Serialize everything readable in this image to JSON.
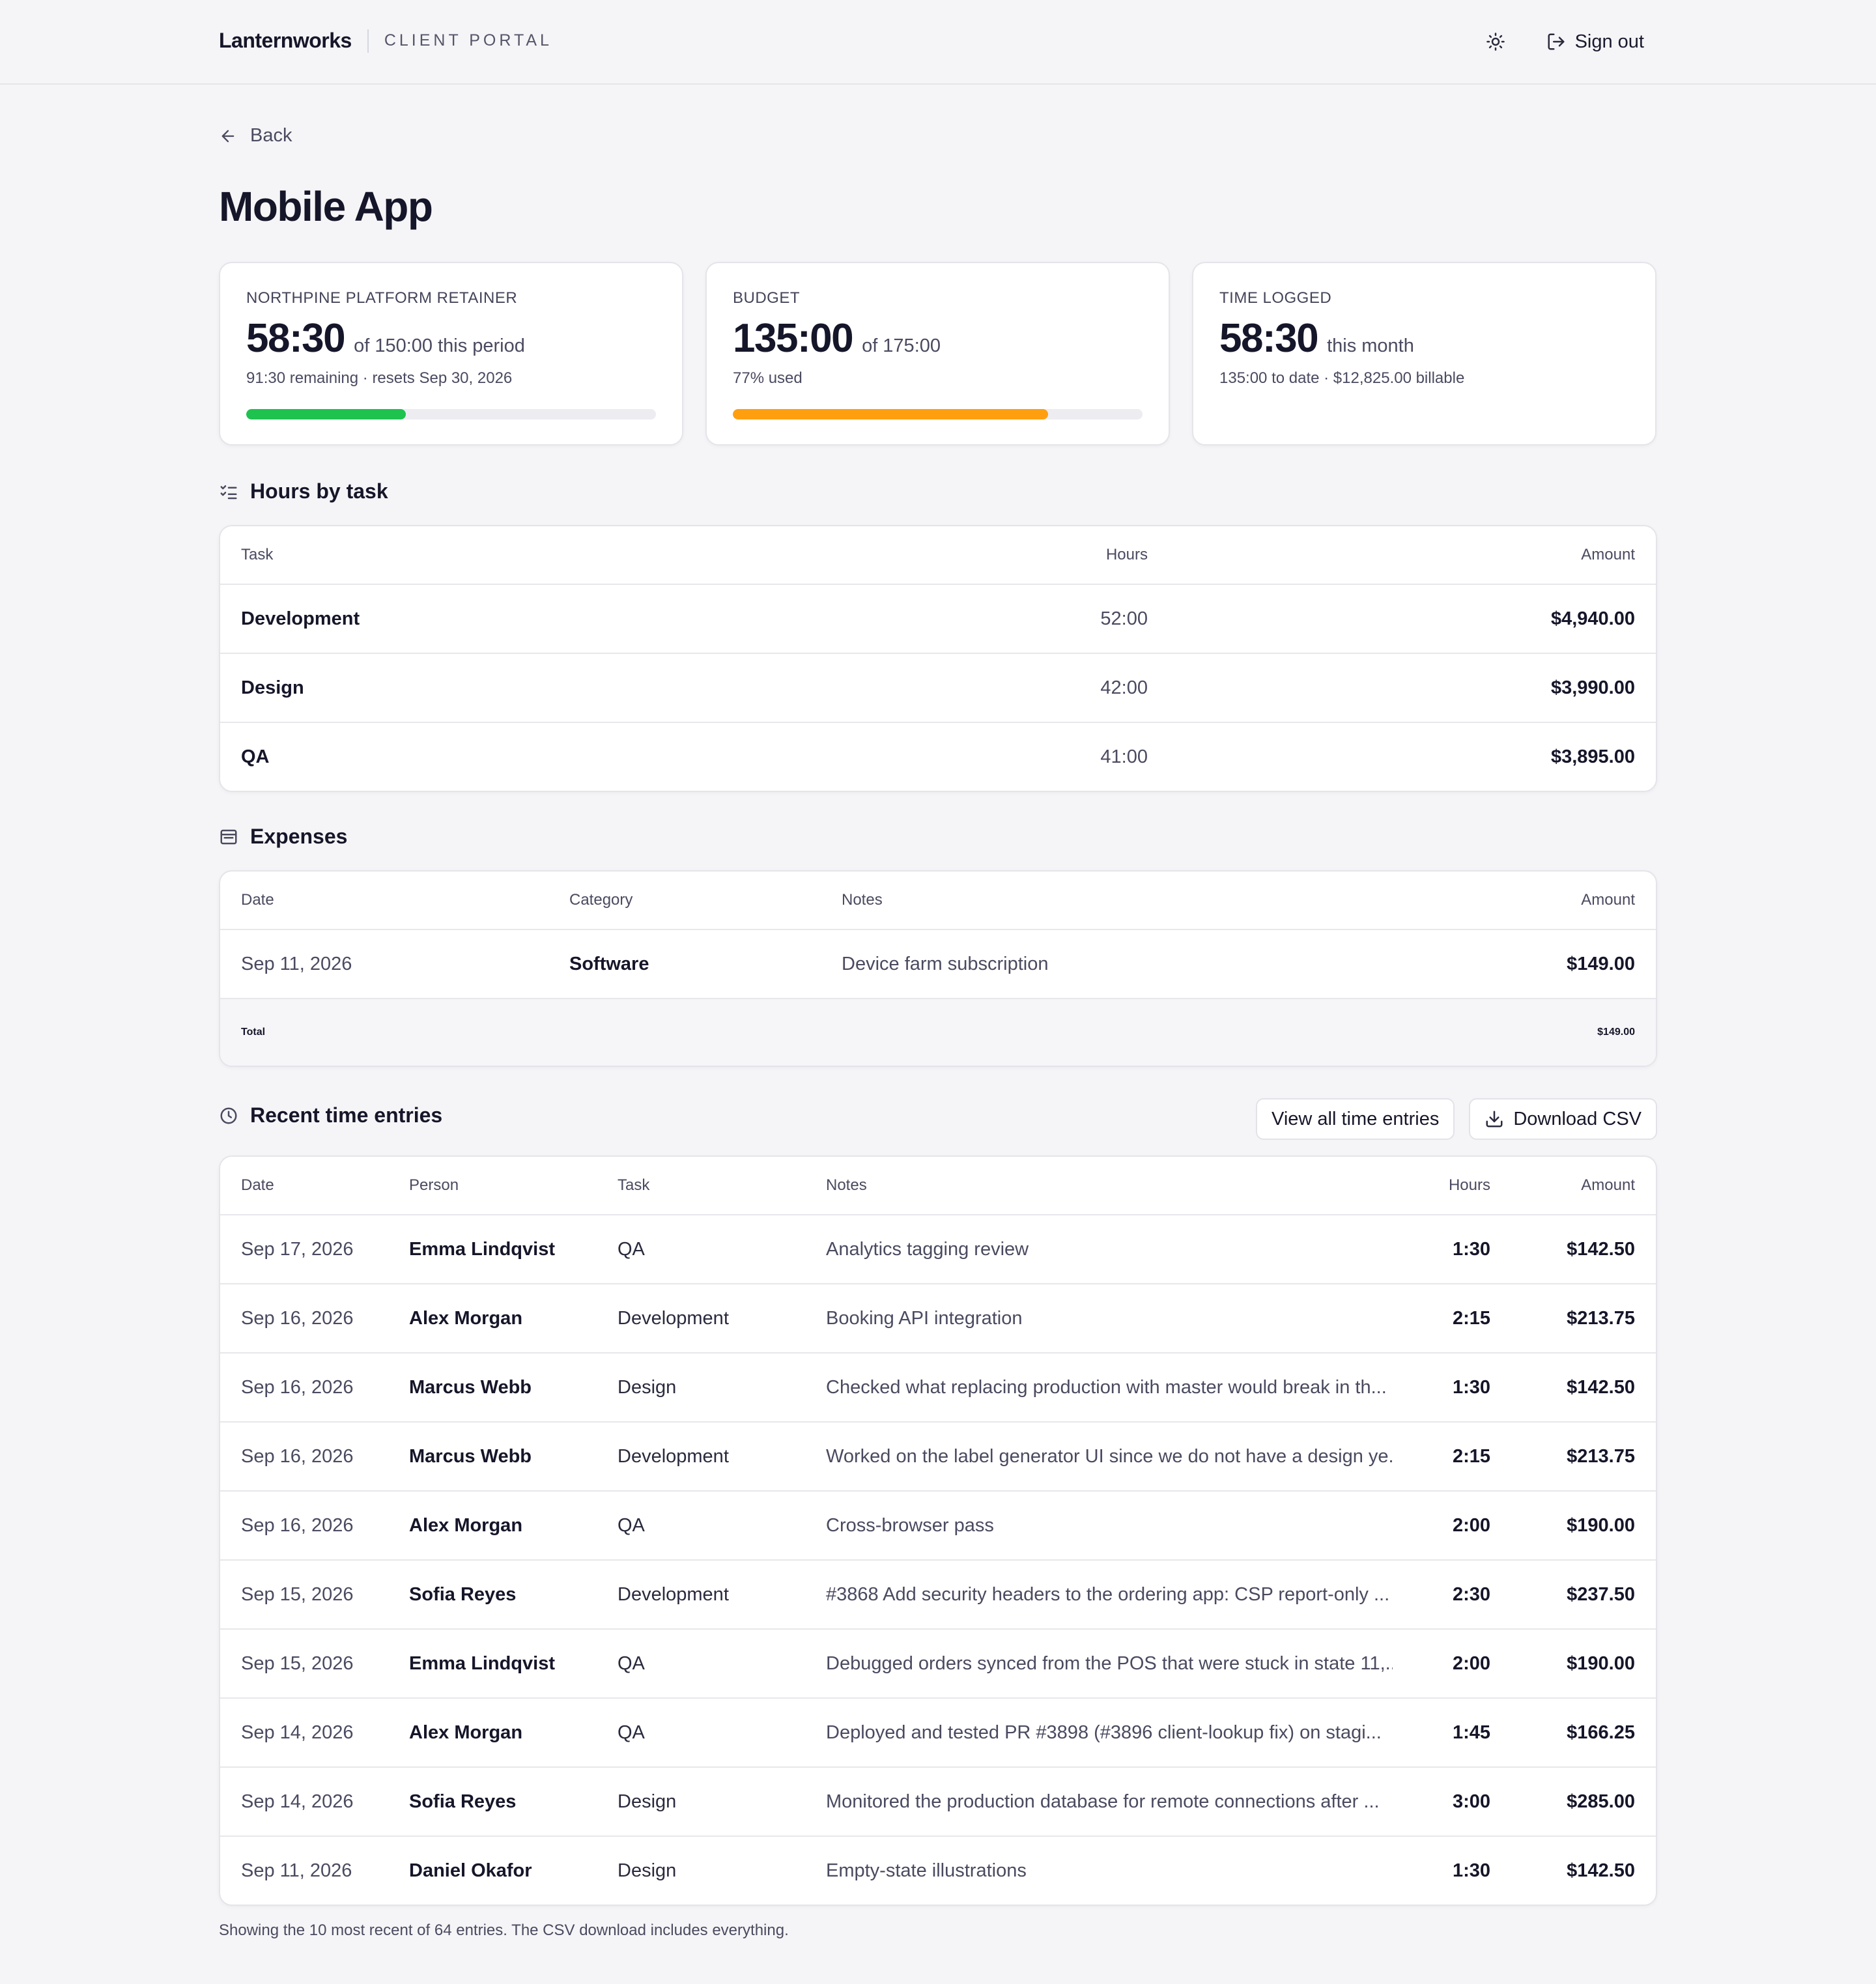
{
  "header": {
    "brand": "Lanternworks",
    "portal_label": "CLIENT PORTAL",
    "theme_icon": "sun-icon",
    "signout_label": "Sign out"
  },
  "nav": {
    "back_label": "Back"
  },
  "page": {
    "title": "Mobile App"
  },
  "cards": [
    {
      "label": "NORTHPINE PLATFORM RETAINER",
      "value": "58:30",
      "suffix": "of 150:00 this period",
      "sub": "91:30 remaining · resets Sep 30, 2026",
      "progress": 0.39,
      "color": "#1ec24f"
    },
    {
      "label": "BUDGET",
      "value": "135:00",
      "suffix": "of 175:00",
      "sub": "77% used",
      "progress": 0.77,
      "color": "#ff9f0f"
    },
    {
      "label": "TIME LOGGED",
      "value": "58:30",
      "suffix": "this month",
      "sub": "135:00 to date · $12,825.00 billable"
    }
  ],
  "hours_by_task": {
    "title": "Hours by task",
    "columns": {
      "task": "Task",
      "hours": "Hours",
      "amount": "Amount"
    },
    "rows": [
      {
        "task": "Development",
        "hours": "52:00",
        "amount": "$4,940.00"
      },
      {
        "task": "Design",
        "hours": "42:00",
        "amount": "$3,990.00"
      },
      {
        "task": "QA",
        "hours": "41:00",
        "amount": "$3,895.00"
      }
    ]
  },
  "expenses": {
    "title": "Expenses",
    "columns": {
      "date": "Date",
      "category": "Category",
      "notes": "Notes",
      "amount": "Amount"
    },
    "rows": [
      {
        "date": "Sep 11, 2026",
        "category": "Software",
        "notes": "Device farm subscription",
        "amount": "$149.00"
      }
    ],
    "total_label": "Total",
    "total_amount": "$149.00"
  },
  "time_entries": {
    "title": "Recent time entries",
    "view_all_label": "View all time entries",
    "download_label": "Download CSV",
    "columns": {
      "date": "Date",
      "person": "Person",
      "task": "Task",
      "notes": "Notes",
      "hours": "Hours",
      "amount": "Amount"
    },
    "rows": [
      {
        "date": "Sep 17, 2026",
        "person": "Emma Lindqvist",
        "task": "QA",
        "notes": "Analytics tagging review",
        "hours": "1:30",
        "amount": "$142.50"
      },
      {
        "date": "Sep 16, 2026",
        "person": "Alex Morgan",
        "task": "Development",
        "notes": "Booking API integration",
        "hours": "2:15",
        "amount": "$213.75"
      },
      {
        "date": "Sep 16, 2026",
        "person": "Marcus Webb",
        "task": "Design",
        "notes": "Checked what replacing production with master would break in th...",
        "hours": "1:30",
        "amount": "$142.50"
      },
      {
        "date": "Sep 16, 2026",
        "person": "Marcus Webb",
        "task": "Development",
        "notes": "Worked on the label generator UI since we do not have a design ye...",
        "hours": "2:15",
        "amount": "$213.75"
      },
      {
        "date": "Sep 16, 2026",
        "person": "Alex Morgan",
        "task": "QA",
        "notes": "Cross-browser pass",
        "hours": "2:00",
        "amount": "$190.00"
      },
      {
        "date": "Sep 15, 2026",
        "person": "Sofia Reyes",
        "task": "Development",
        "notes": "#3868 Add security headers to the ordering app: CSP report-only ...",
        "hours": "2:30",
        "amount": "$237.50"
      },
      {
        "date": "Sep 15, 2026",
        "person": "Emma Lindqvist",
        "task": "QA",
        "notes": "Debugged orders synced from the POS that were stuck in state 11,...",
        "hours": "2:00",
        "amount": "$190.00"
      },
      {
        "date": "Sep 14, 2026",
        "person": "Alex Morgan",
        "task": "QA",
        "notes": "Deployed and tested PR #3898 (#3896 client-lookup fix) on stagi...",
        "hours": "1:45",
        "amount": "$166.25"
      },
      {
        "date": "Sep 14, 2026",
        "person": "Sofia Reyes",
        "task": "Design",
        "notes": "Monitored the production database for remote connections after ...",
        "hours": "3:00",
        "amount": "$285.00"
      },
      {
        "date": "Sep 11, 2026",
        "person": "Daniel Okafor",
        "task": "Design",
        "notes": "Empty-state illustrations",
        "hours": "1:30",
        "amount": "$142.50"
      }
    ],
    "footnote": "Showing the 10 most recent of 64 entries. The CSV download includes everything."
  }
}
